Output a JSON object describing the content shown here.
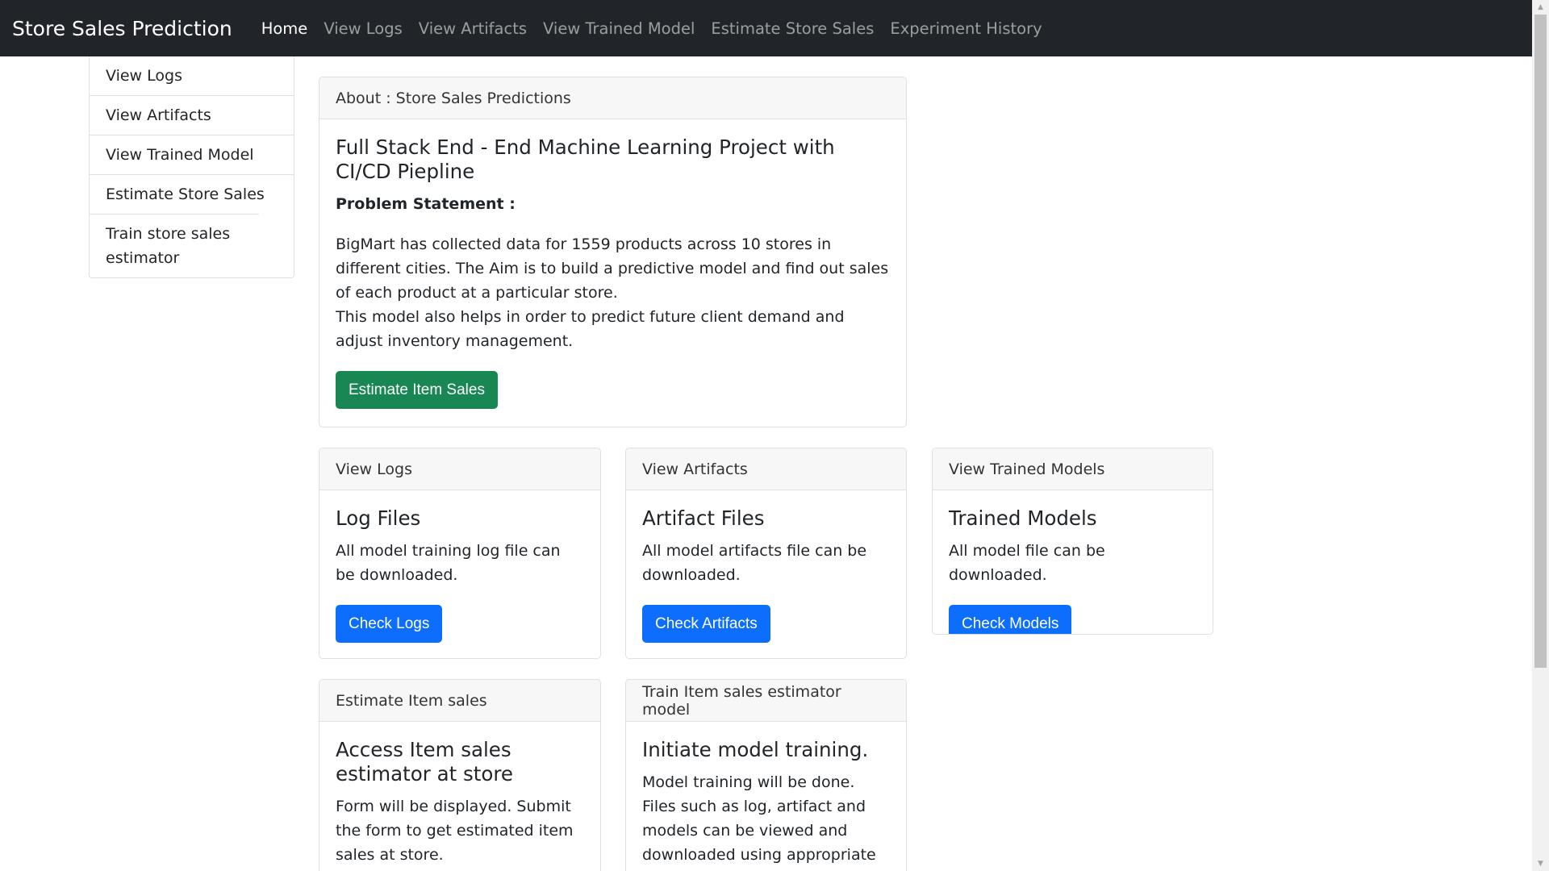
{
  "navbar": {
    "brand": "Store Sales Prediction",
    "links": [
      {
        "label": "Home",
        "active": true
      },
      {
        "label": "View Logs"
      },
      {
        "label": "View Artifacts"
      },
      {
        "label": "View Trained Model"
      },
      {
        "label": "Estimate Store Sales"
      },
      {
        "label": "Experiment History"
      }
    ]
  },
  "sidebar": {
    "items": [
      {
        "label": "View Logs"
      },
      {
        "label": "View Artifacts"
      },
      {
        "label": "View Trained Model"
      },
      {
        "label": "Estimate Store Sales"
      },
      {
        "label": "Train store sales estimator"
      }
    ]
  },
  "about": {
    "header": "About : Store Sales Predictions",
    "title": "Full Stack End - End Machine Learning Project with CI/CD Piepline",
    "problem_label": "Problem Statement :",
    "text1": "BigMart has collected data for 1559 products across 10 stores in different cities. The Aim is to build a predictive model and find out sales of each product at a particular store.",
    "text2": "This model also helps in order to predict future client demand and adjust inventory management.",
    "button": "Estimate Item Sales"
  },
  "cards": [
    {
      "header": "View Logs",
      "title": "Log Files",
      "text": "All model training log file can be downloaded.",
      "button": "Check Logs"
    },
    {
      "header": "View Artifacts",
      "title": "Artifact Files",
      "text": "All model artifacts file can be downloaded.",
      "button": "Check Artifacts"
    },
    {
      "header": "View Trained Models",
      "title": "Trained Models",
      "text": "All model file can be downloaded.",
      "button": "Check Models"
    },
    {
      "header": "Estimate Item sales",
      "title": "Access Item sales estimator at store",
      "text": "Form will be displayed. Submit the form to get estimated item sales at store."
    },
    {
      "header": "Train Item sales estimator model",
      "title": "Initiate model training.",
      "text": "Model training will be done. Files such as log, artifact and models can be viewed and downloaded using appropriate link."
    }
  ],
  "colors": {
    "navbar_bg": "#212529",
    "success": "#198754",
    "primary": "#0d6efd"
  }
}
